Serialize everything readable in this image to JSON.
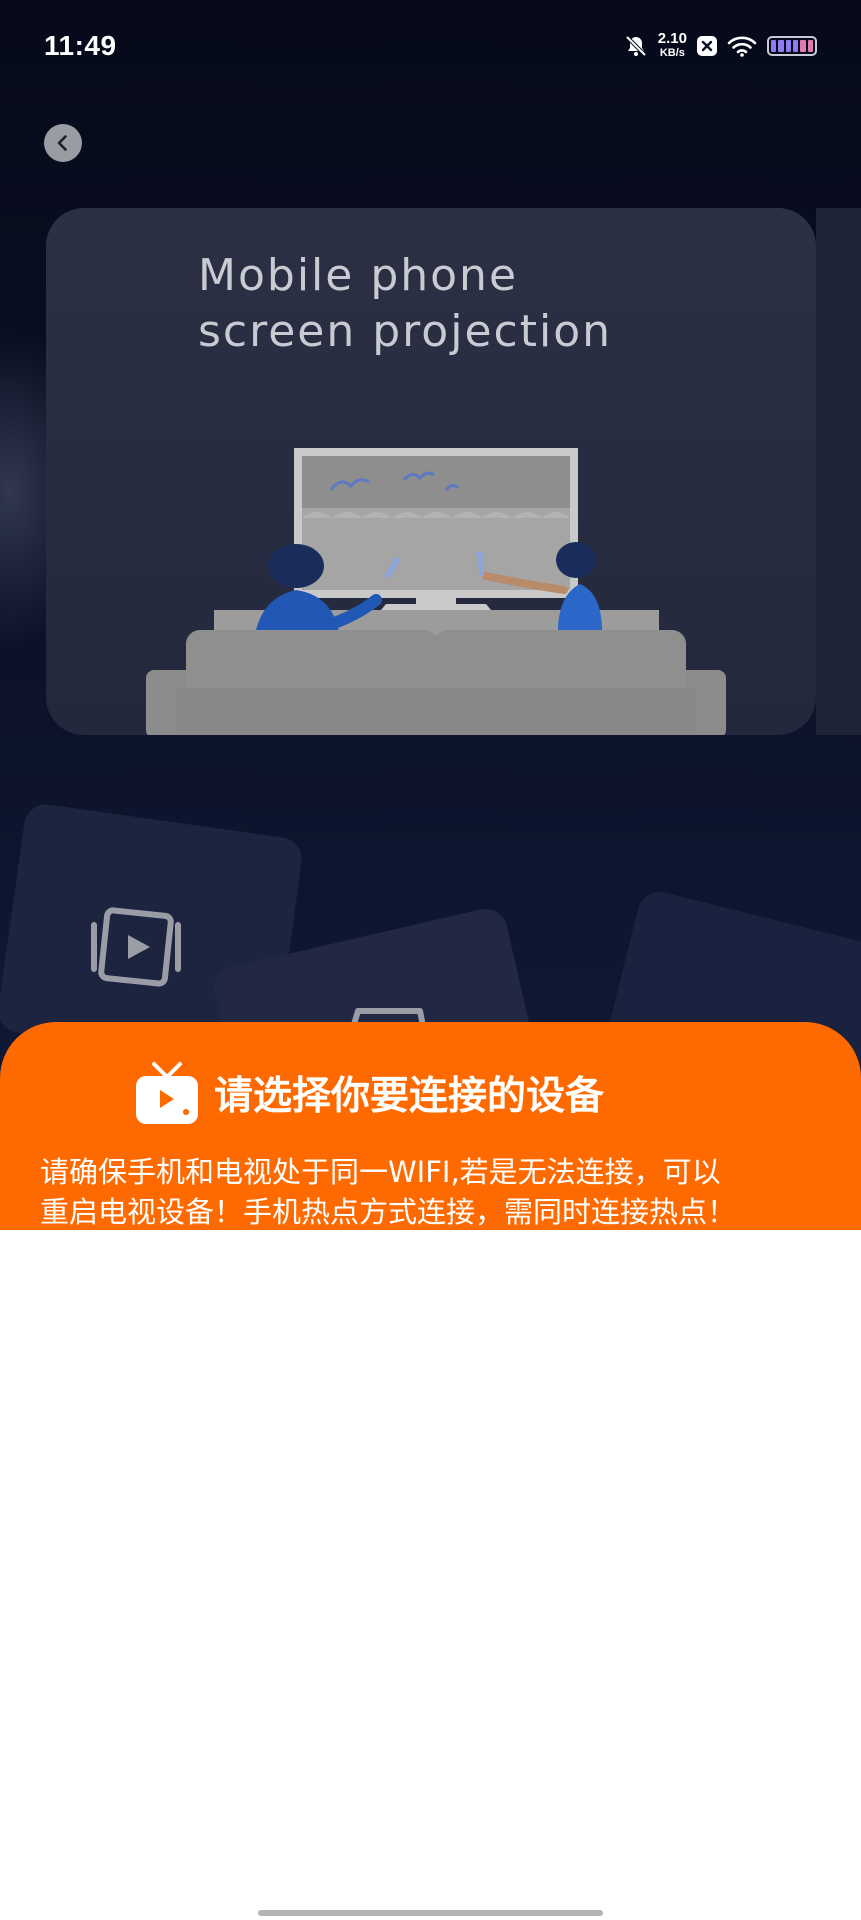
{
  "status_bar": {
    "time": "11:49",
    "net_speed_value": "2.10",
    "net_speed_unit": "KB/s",
    "icons": [
      "bell-off-icon",
      "close-box-icon",
      "wifi-icon",
      "battery-icon"
    ]
  },
  "nav": {
    "back_icon": "chevron-left-icon"
  },
  "hero": {
    "title_line1": "Mobile phone",
    "title_line2": "screen projection"
  },
  "panel": {
    "icon": "tv-icon",
    "title": "请选择你要连接的设备",
    "desc_line1": "请确保手机和电视处于同一WIFI,若是无法连接，可以",
    "desc_line2": "重启电视设备！手机热点方式连接，需同时连接热点！"
  },
  "colors": {
    "accent": "#ff6a00",
    "background_dark": "#0a1024",
    "card": "#2a2e42"
  }
}
